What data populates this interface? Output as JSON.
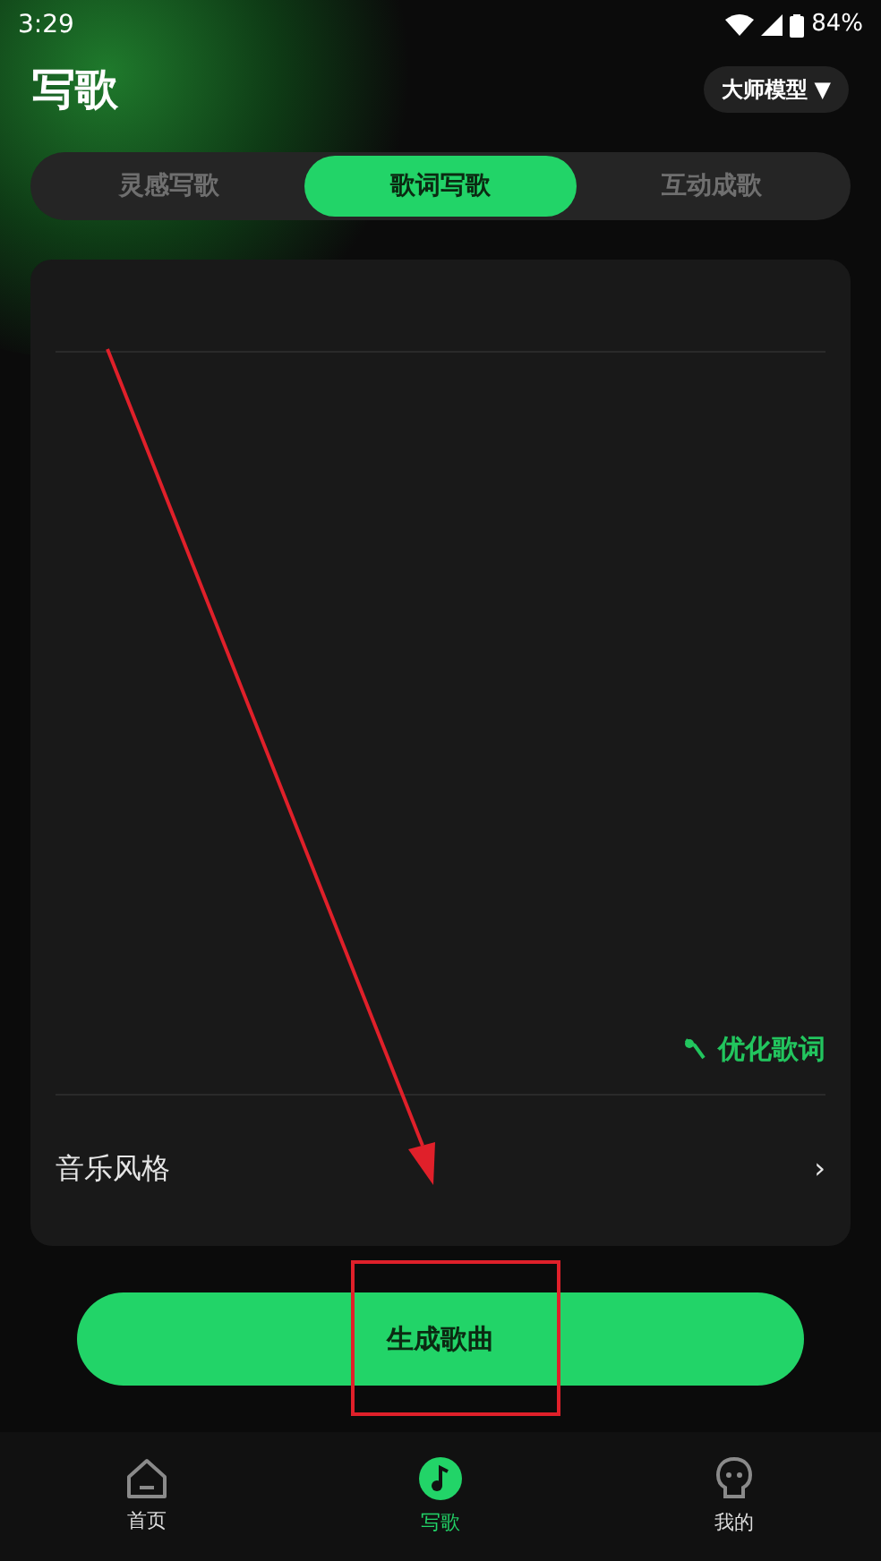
{
  "status_bar": {
    "time": "3:29",
    "battery": "84%"
  },
  "header": {
    "title": "写歌",
    "model_button": "大师模型",
    "model_caret": "▼"
  },
  "tabs": [
    {
      "label": "灵感写歌",
      "selected": false
    },
    {
      "label": "歌词写歌",
      "selected": true
    },
    {
      "label": "互动成歌",
      "selected": false
    }
  ],
  "editor": {
    "optimize_button": "优化歌词",
    "style_row": {
      "label": "音乐风格",
      "chevron": "›"
    }
  },
  "generate_button": "生成歌曲",
  "bottom_nav": [
    {
      "label": "首页",
      "kind": "home",
      "selected": false
    },
    {
      "label": "写歌",
      "kind": "music",
      "selected": true
    },
    {
      "label": "我的",
      "kind": "profile",
      "selected": false
    }
  ]
}
